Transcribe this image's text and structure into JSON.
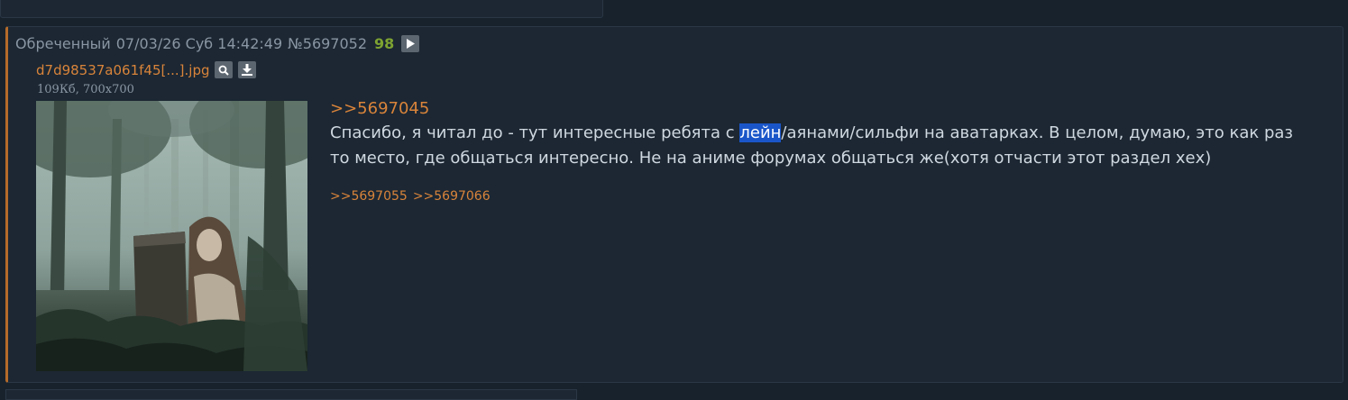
{
  "post": {
    "name": "Обреченный",
    "date": "07/03/26 Суб 14:42:49",
    "number": "№5697052",
    "count": "98",
    "file": {
      "name": "d7d98537a061f45[...].jpg",
      "meta": "109Кб, 700x700",
      "icons": [
        "search-icon",
        "download-icon"
      ]
    },
    "reply_to": ">>5697045",
    "message": {
      "before": "Спасибо, я читал до - тут интересные ребята с ",
      "highlight": "лейн",
      "after": "/аянами/сильфи на аватарках. В целом, думаю, это как раз то место, где общаться интересно. Не на аниме форумах общаться же(хотя отчасти этот раздел хех)"
    },
    "replies": [
      ">>5697055",
      ">>5697066"
    ]
  },
  "colors": {
    "accent": "#d9843a",
    "count": "#7ea331",
    "background": "#18222d",
    "post_background": "#1c2733",
    "highlight": "#1a56c9"
  }
}
